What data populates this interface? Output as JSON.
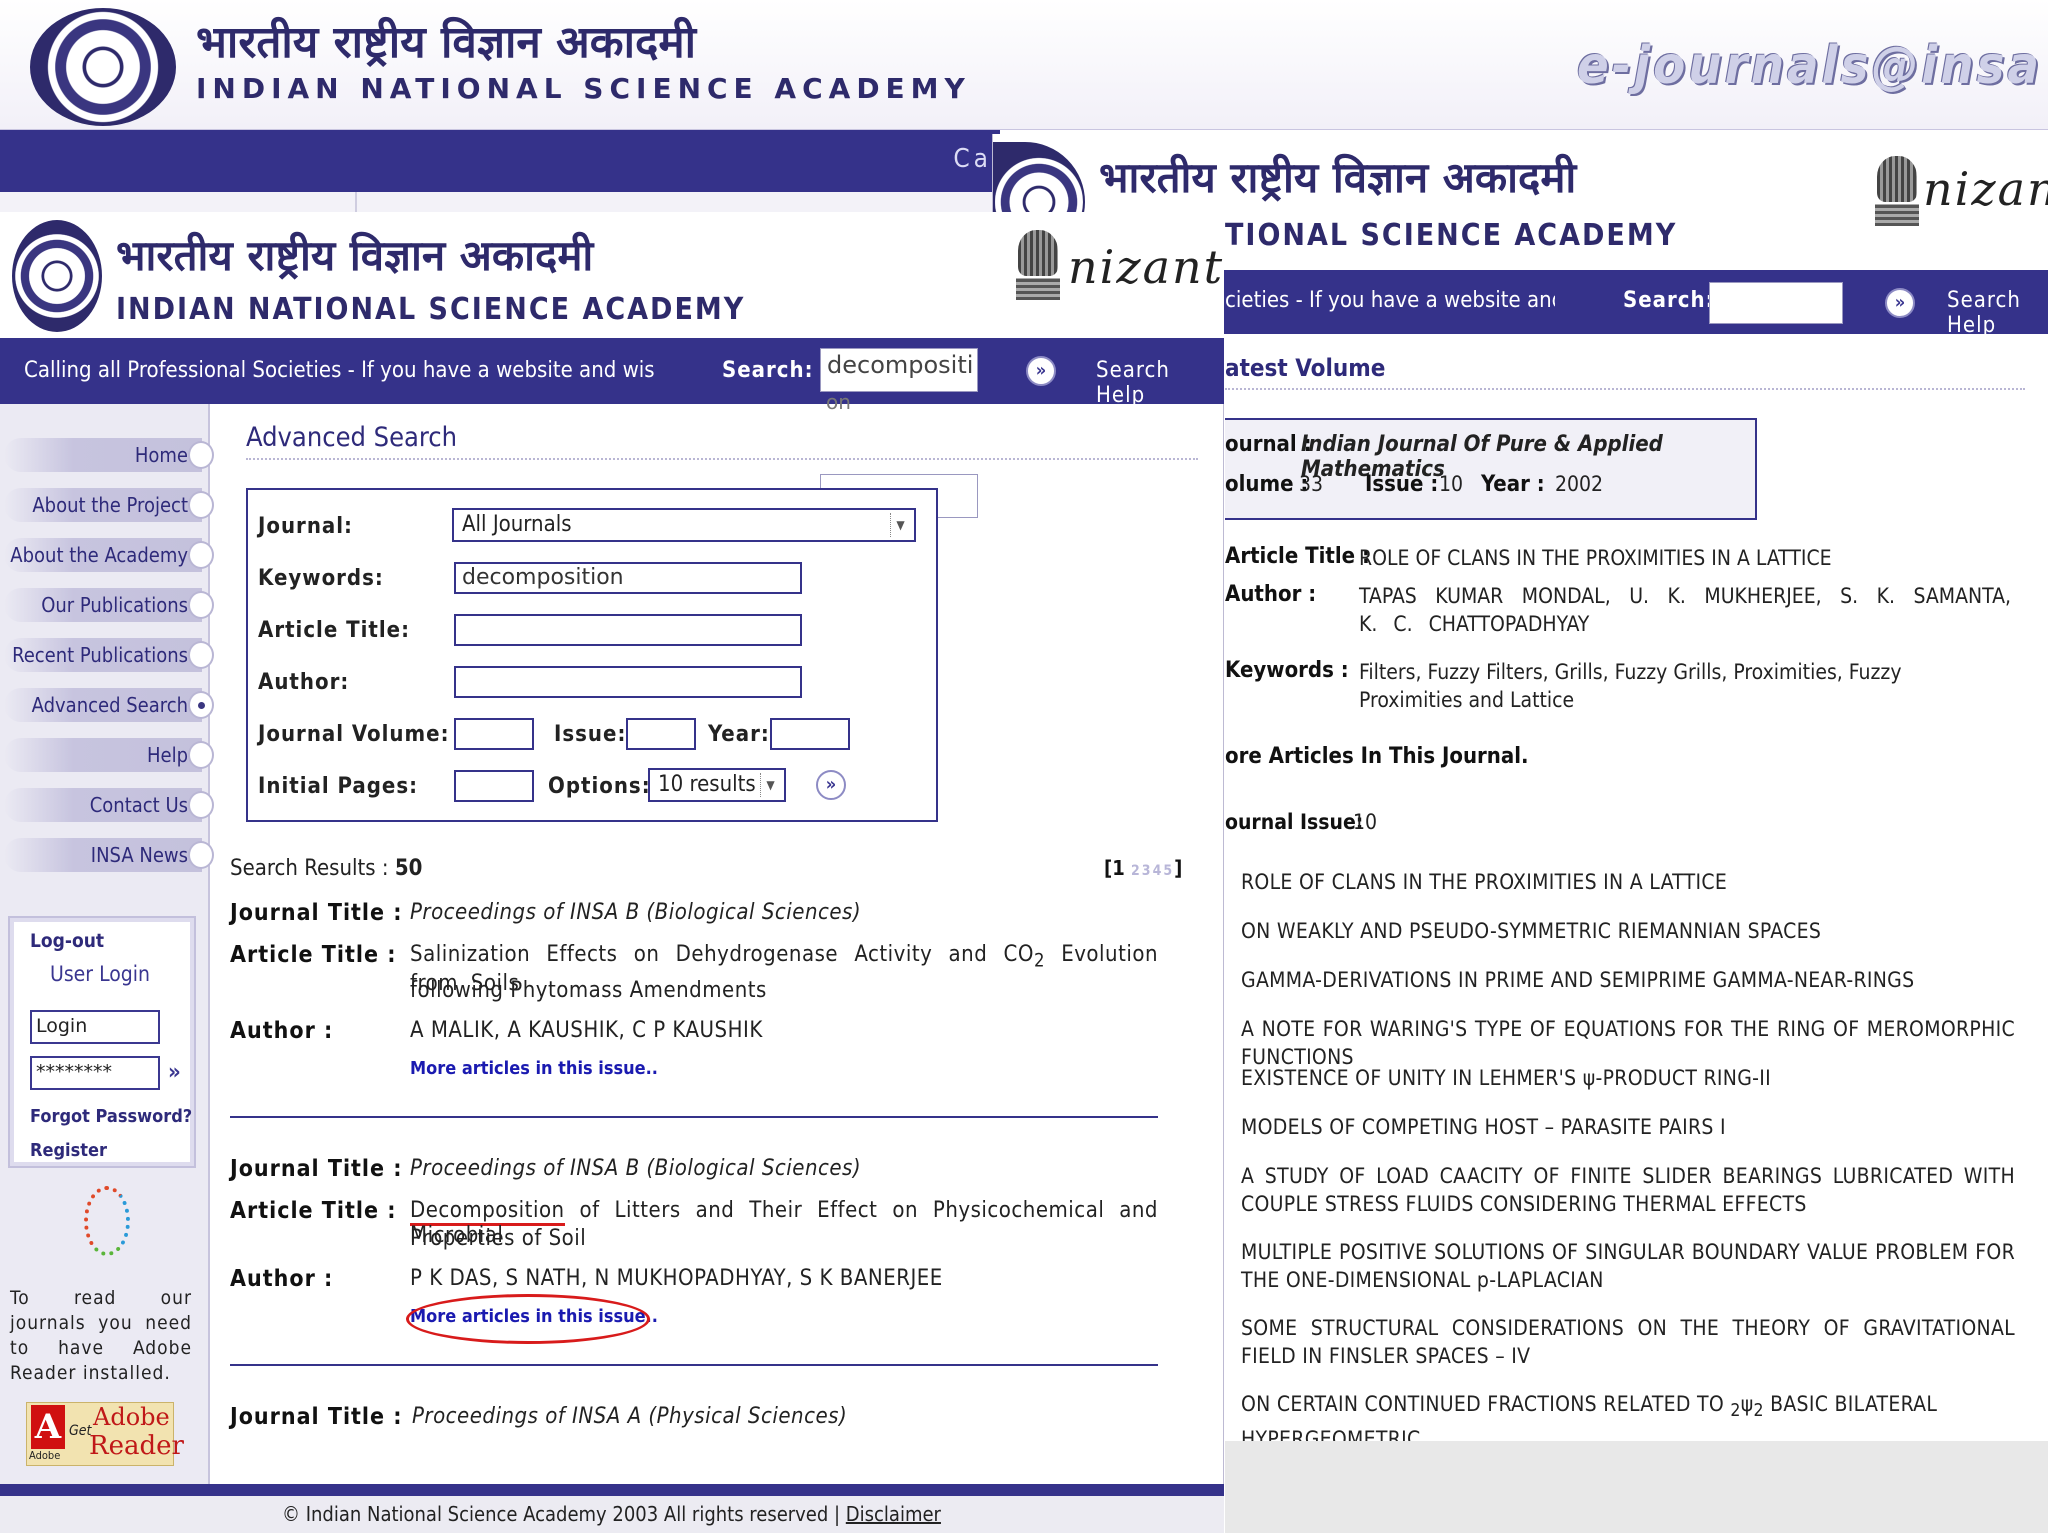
{
  "academy": {
    "hindi_name": "भारतीय राष्ट्रीय विज्ञान अकादमी",
    "english_name": "INDIAN NATIONAL SCIENCE ACADEMY",
    "english_name_cropped": "TIONAL SCIENCE ACADEMY",
    "ejournals_logo": "e-journals@insa",
    "nizant_logo": "nizant"
  },
  "back_window": {
    "nav_fragment": "Ca"
  },
  "front_nav": {
    "marquee": "Calling all Professional Societies - If you have a website and wish t",
    "search_label": "Search:",
    "search_value": "decompositi",
    "search_overflow": "on",
    "search_help": "Search Help"
  },
  "right_nav": {
    "marquee": "cieties - If you have a website and wish t",
    "search_label": "Search:",
    "search_value": "",
    "search_help": "Search Help"
  },
  "sidebar": {
    "items": [
      {
        "label": "Home"
      },
      {
        "label": "About the Project"
      },
      {
        "label": "About the Academy"
      },
      {
        "label": "Our Publications"
      },
      {
        "label": "Recent Publications"
      },
      {
        "label": "Advanced Search",
        "active": true
      },
      {
        "label": "Help"
      },
      {
        "label": "Contact Us"
      },
      {
        "label": "INSA News"
      }
    ],
    "logout": "Log-out",
    "user_login": "User Login",
    "login_value": "Login",
    "password_value": "********",
    "forgot": "Forgot Password?",
    "register": "Register",
    "adobe_note": "To read our journals you need to have Adobe Reader installed.",
    "adobe_brand": "Adobe",
    "adobe_get": "Get",
    "adobe_reader_top": "Adobe",
    "adobe_reader_bottom": "Reader"
  },
  "advanced_search": {
    "title": "Advanced Search",
    "journal_label": "Journal:",
    "journal_value": "All Journals",
    "keywords_label": "Keywords:",
    "keywords_value": "decomposition",
    "article_title_label": "Article Title:",
    "author_label": "Author:",
    "volume_label": "Journal Volume:",
    "issue_label": "Issue:",
    "year_label": "Year:",
    "pages_label": "Initial Pages:",
    "options_label": "Options:",
    "options_value": "10 results"
  },
  "results": {
    "summary_label": "Search Results :",
    "count": "50",
    "pages": [
      "1",
      "2",
      "3",
      "4",
      "5"
    ],
    "labels": {
      "journal": "Journal Title :",
      "article": "Article Title :",
      "author": "Author :",
      "more": "More articles in this issue.."
    },
    "items": [
      {
        "journal": "Proceedings of INSA B (Biological Sciences)",
        "title_pre": "Salinization Effects on Dehydrogenase Activity and CO",
        "title_sub": "2",
        "title_post": " Evolution from Soils",
        "title_line2": "following Phytomass Amendments",
        "author": "A MALIK, A KAUSHIK, C P KAUSHIK"
      },
      {
        "journal": "Proceedings of INSA B (Biological Sciences)",
        "title_keyword": "Decomposition",
        "title_rest": " of Litters and Their Effect on Physicochemical and Microbial",
        "title_line2": "Properties of Soil",
        "author": "P K DAS, S NATH, N MUKHOPADHYAY, S K BANERJEE"
      },
      {
        "journal": "Proceedings of INSA A (Physical Sciences)"
      }
    ]
  },
  "footer": {
    "copyright": "© Indian National Science Academy 2003 All rights reserved |",
    "disclaimer": "Disclaimer"
  },
  "right_panel": {
    "section_title": "atest Volume",
    "journal_label": "ournal :",
    "journal_value": "Indian Journal Of Pure & Applied Mathematics",
    "volume_label": "olume :",
    "volume_value": "33",
    "issue_label": "Issue :",
    "issue_value": "10",
    "year_label": "Year :",
    "year_value": "2002",
    "article_label": "Article Title :",
    "article_value": "ROLE OF CLANS IN THE PROXIMITIES IN A LATTICE",
    "author_label": "Author :",
    "author_value": "TAPAS KUMAR MONDAL, U. K. MUKHERJEE, S. K. SAMANTA, K. C. CHATTOPADHYAY",
    "keywords_label": "Keywords :",
    "keywords_value": "Filters, Fuzzy Filters, Grills, Fuzzy Grills, Proximities, Fuzzy Proximities and Lattice",
    "more_articles": "ore Articles In This Journal.",
    "journal_issue_label": "ournal Issue:",
    "journal_issue_value": "10",
    "articles": [
      "ROLE OF CLANS IN THE PROXIMITIES IN A LATTICE",
      "ON WEAKLY AND PSEUDO-SYMMETRIC RIEMANNIAN SPACES",
      "GAMMA-DERIVATIONS IN PRIME AND SEMIPRIME GAMMA-NEAR-RINGS",
      "A NOTE FOR WARING'S TYPE OF EQUATIONS FOR THE RING OF MEROMORPHIC FUNCTIONS",
      "EXISTENCE OF UNITY IN LEHMER'S ψ-PRODUCT RING-II",
      "MODELS OF COMPETING HOST – PARASITE PAIRS I",
      "A STUDY OF LOAD CAACITY OF FINITE SLIDER BEARINGS LUBRICATED WITH COUPLE STRESS FLUIDS CONSIDERING THERMAL EFFECTS",
      "MULTIPLE POSITIVE SOLUTIONS OF SINGULAR BOUNDARY VALUE PROBLEM FOR THE ONE-DIMENSIONAL p-LAPLACIAN",
      "SOME STRUCTURAL CONSIDERATIONS ON THE THEORY OF GRAVITATIONAL FIELD IN FINSLER SPACES – IV"
    ],
    "last_article_pre": "ON CERTAIN CONTINUED FRACTIONS RELATED TO ",
    "last_article_sub1": "2",
    "last_article_psi": "ψ",
    "last_article_sub2": "2",
    "last_article_post": " BASIC BILATERAL HYPERGEOMETRIC"
  },
  "colors": {
    "brand": "#35328a",
    "link": "#1a1ab0",
    "highlight": "#d81b1b"
  }
}
